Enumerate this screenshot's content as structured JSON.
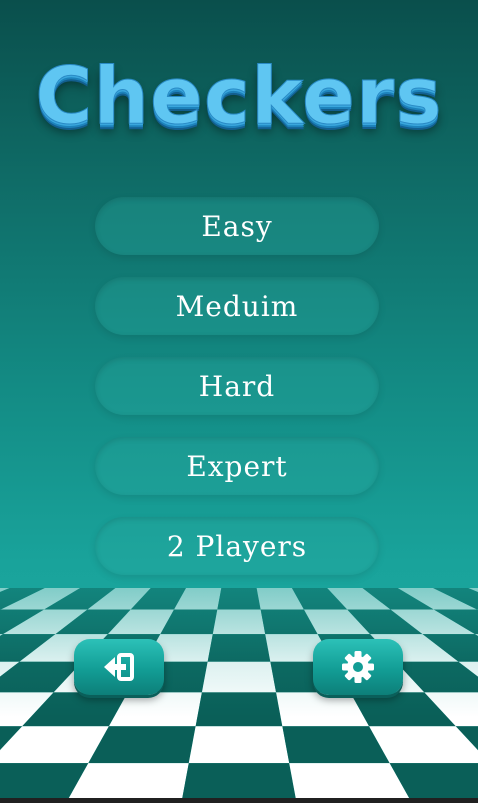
{
  "app": {
    "title": "Checkers"
  },
  "menu": {
    "items": [
      {
        "label": "Easy"
      },
      {
        "label": "Meduim"
      },
      {
        "label": "Hard"
      },
      {
        "label": "Expert"
      },
      {
        "label": "2 Players"
      }
    ]
  },
  "buttons": {
    "exit_icon": "exit-icon",
    "settings_icon": "gear-icon"
  },
  "colors": {
    "title": "#5fc6f2",
    "board_dark": "#0a5f58",
    "board_light": "#ffffff",
    "button": "#129d95"
  }
}
